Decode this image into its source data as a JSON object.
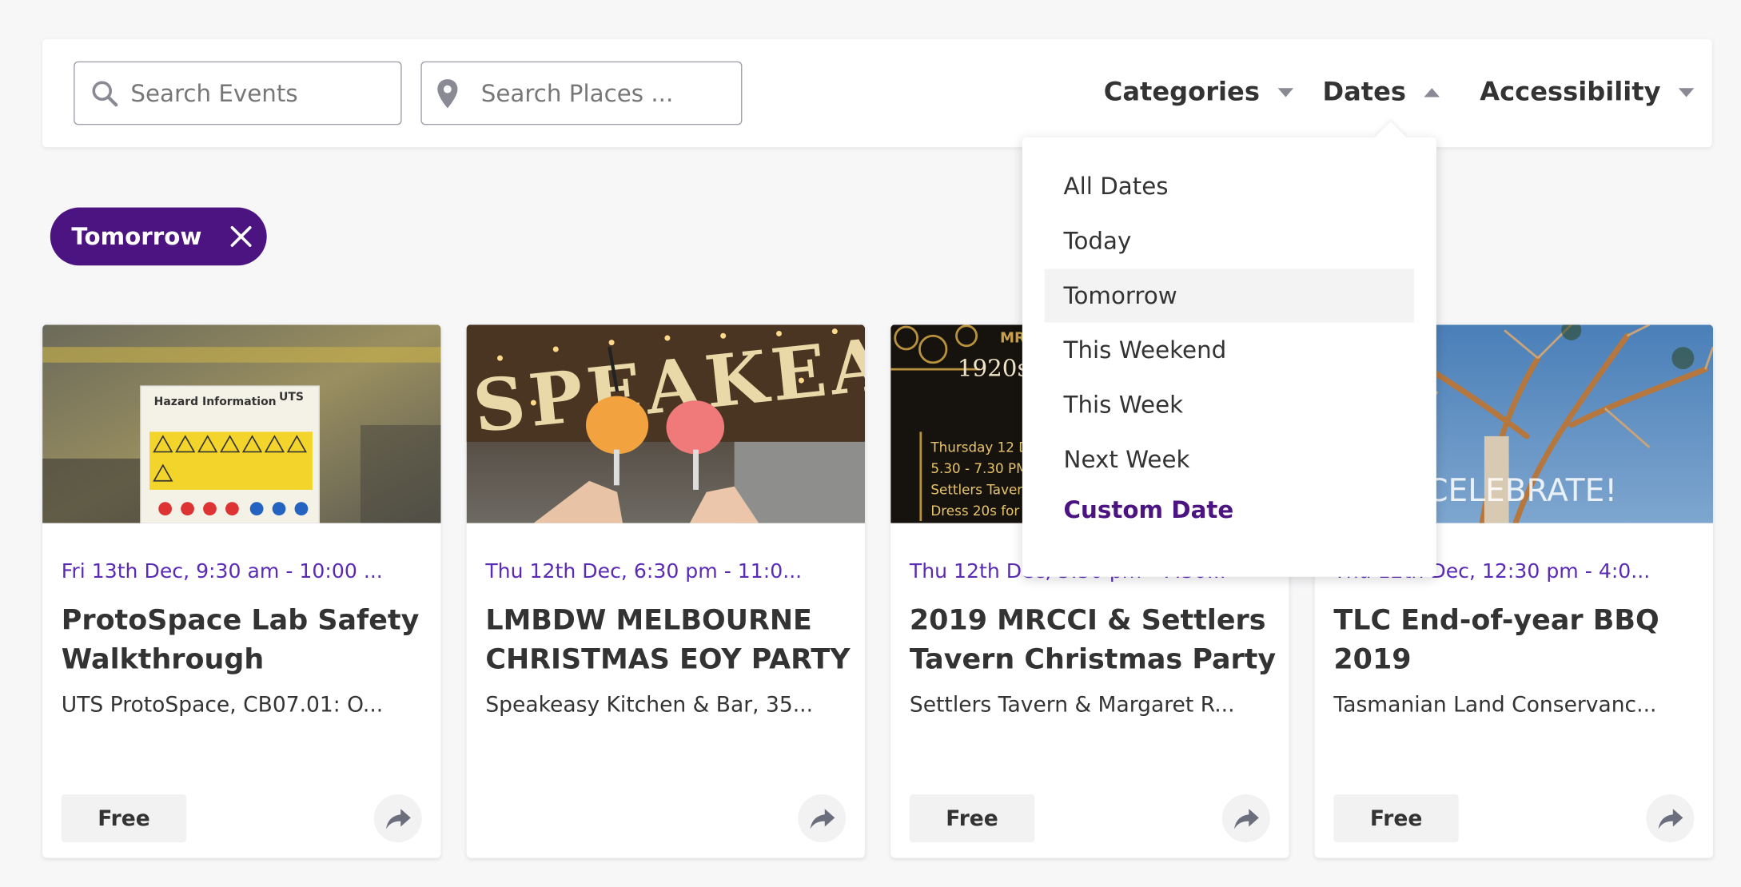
{
  "filters": {
    "search_events_placeholder": "Search Events",
    "search_places_placeholder": "Search Places ...",
    "categories_label": "Categories",
    "dates_label": "Dates",
    "accessibility_label": "Accessibility"
  },
  "active_chip": {
    "label": "Tomorrow"
  },
  "dates_menu": {
    "items": [
      "All Dates",
      "Today",
      "Tomorrow",
      "This Weekend",
      "This Week",
      "Next Week"
    ],
    "highlighted": "Tomorrow",
    "custom_label": "Custom Date"
  },
  "cards": [
    {
      "date": "Fri 13th Dec, 9:30 am - 10:00 ...",
      "title": "ProtoSpace Lab Safety Walkthrough",
      "venue": "UTS ProtoSpace, CB07.01: O...",
      "price": "Free",
      "image_text": [
        "Hazard Information",
        "UTS"
      ]
    },
    {
      "date": "Thu 12th Dec, 6:30 pm - 11:0...",
      "title": "LMBDW MELBOURNE CHRISTMAS EOY PARTY",
      "venue": "Speakeasy Kitchen & Bar, 35...",
      "price": "",
      "image_text": [
        "SPEAKEASY"
      ]
    },
    {
      "date": "Thu 12th Dec, 5:30 pm - 7:30...",
      "title": "2019 MRCCI & Settlers Tavern Christmas Party",
      "venue": "Settlers Tavern & Margaret R...",
      "price": "Free",
      "image_text": [
        "MR",
        "1920s",
        "Thursday 12 D",
        "5.30 - 7.30 PM",
        "Settlers Taver",
        "Dress 20s for"
      ]
    },
    {
      "date": "Thu 12th Dec, 12:30 pm - 4:0...",
      "title": "TLC End-of-year BBQ 2019",
      "venue": "Tasmanian Land Conservanc...",
      "price": "Free",
      "image_text": [
        "CELEBRATE!"
      ]
    }
  ],
  "colors": {
    "accent": "#4b1480",
    "date_text": "#5b2bb5",
    "background": "#f7f7f8"
  }
}
